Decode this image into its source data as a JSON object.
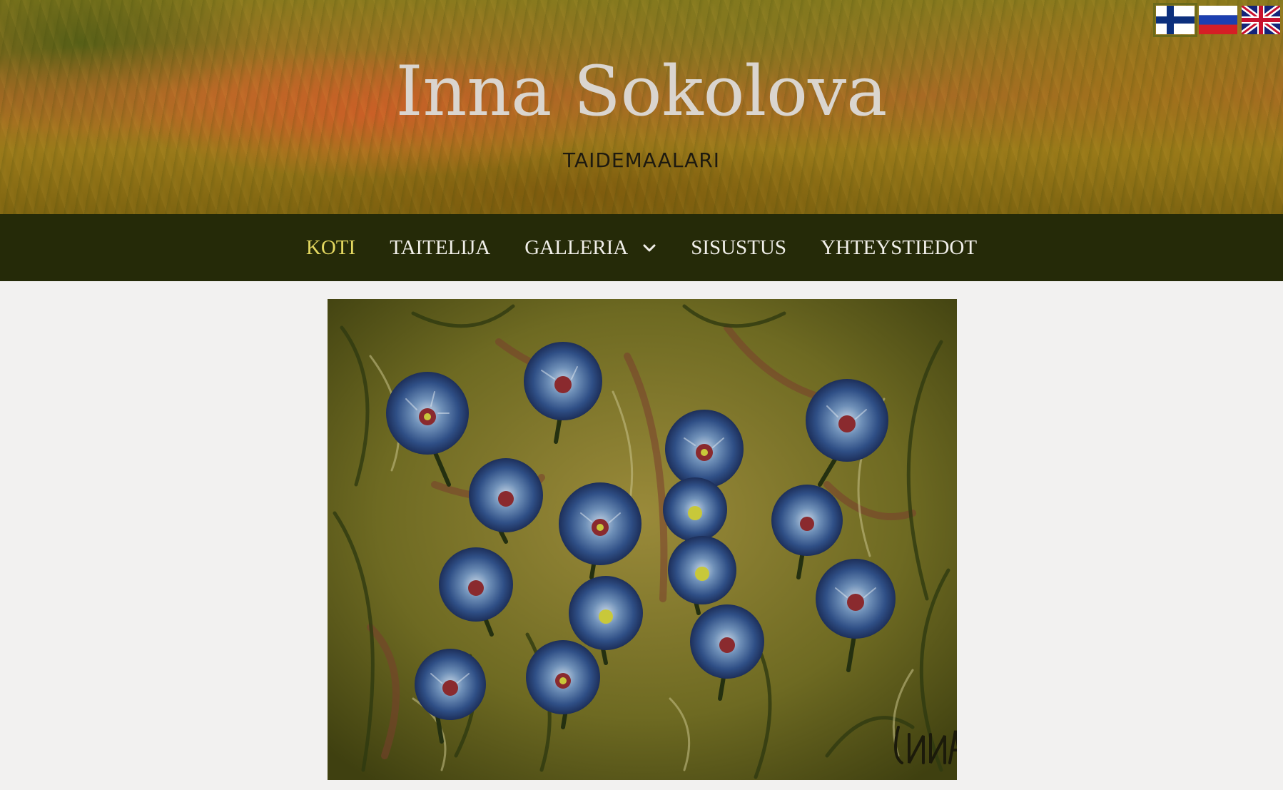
{
  "header": {
    "title": "Inna Sokolova",
    "subtitle": "TAIDEMAALARI"
  },
  "languages": [
    {
      "code": "fi",
      "icon": "finland-flag-icon",
      "active": true
    },
    {
      "code": "ru",
      "icon": "russia-flag-icon",
      "active": false
    },
    {
      "code": "en",
      "icon": "uk-flag-icon",
      "active": false
    }
  ],
  "nav": {
    "items": [
      {
        "label": "KOTI",
        "active": true
      },
      {
        "label": "TAITELIJA"
      },
      {
        "label": "GALLERIA",
        "has_dropdown": true,
        "dropdown_icon": "chevron-down-icon"
      },
      {
        "label": "SISUSTUS"
      },
      {
        "label": "YHTEYSTIEDOT"
      }
    ]
  },
  "hero_image": {
    "subject": "painting of blue cornflowers in grass",
    "signature": "Inna"
  },
  "colors": {
    "nav_bg": "#252a08",
    "nav_active": "#e4d860",
    "nav_text": "#f1efe9",
    "page_bg": "#f2f1f0",
    "title_color": "#dad5cf"
  }
}
